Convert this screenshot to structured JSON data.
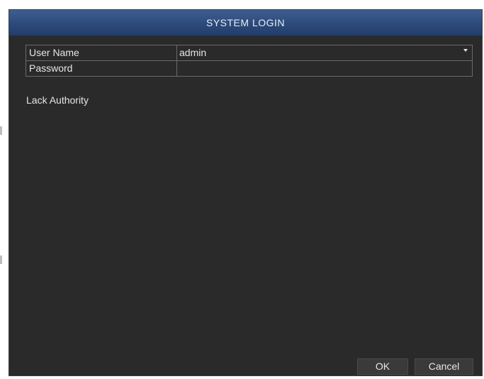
{
  "window": {
    "title": "SYSTEM LOGIN"
  },
  "form": {
    "username_label": "User Name",
    "username_value": "admin",
    "password_label": "Password",
    "password_value": ""
  },
  "status": {
    "message": "Lack Authority"
  },
  "buttons": {
    "ok_label": "OK",
    "cancel_label": "Cancel"
  },
  "colors": {
    "titlebar": "#2c4a7b",
    "background": "#2a2a2a",
    "text": "#e6e6e6"
  }
}
